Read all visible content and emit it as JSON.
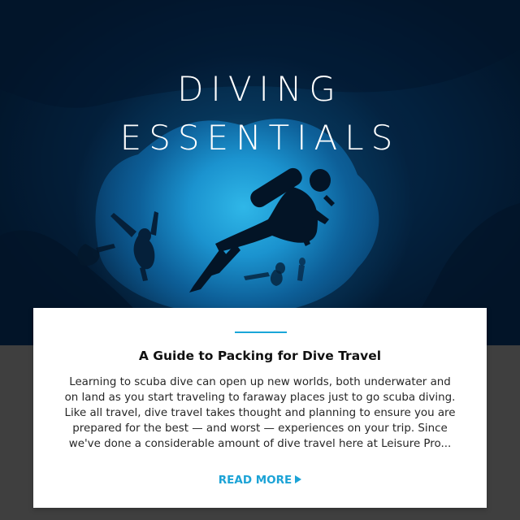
{
  "hero": {
    "headline_line1": "DIVING",
    "headline_line2": "ESSENTIALS",
    "image_subject": "scuba divers silhouetted in an underwater cave"
  },
  "article": {
    "title": "A Guide to Packing for Dive Travel",
    "excerpt": "Learning to scuba dive can open up new worlds, both underwater and on land as you start traveling to faraway places just to go scuba diving. Like all travel, dive travel takes thought and planning to ensure you are prepared for the best — and worst — experiences on your trip. Since we've done a considerable amount of dive travel here at Leisure Pro...",
    "read_more_label": "READ MORE",
    "read_more_icon": "play-arrow-icon"
  },
  "colors": {
    "accent": "#1ca3d6",
    "band_background": "#3f3f3f",
    "card_background": "#ffffff"
  }
}
